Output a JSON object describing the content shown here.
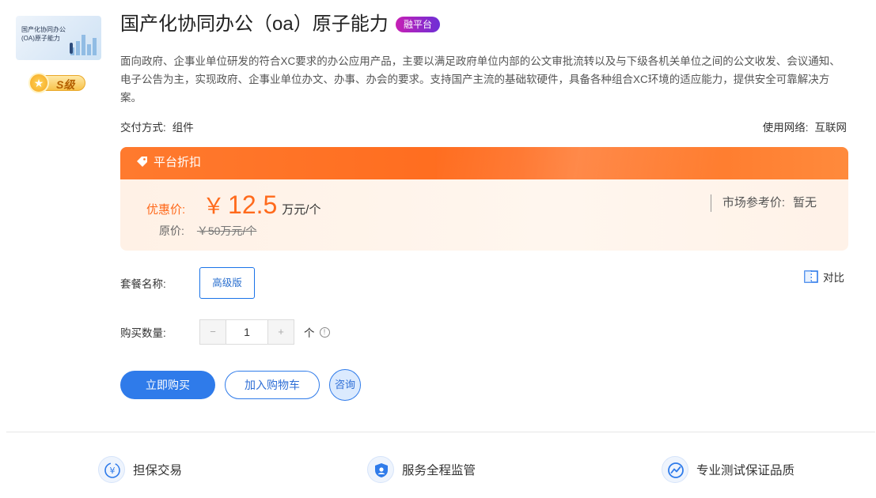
{
  "product": {
    "thumbnail_text_line1": "国产化协同办公",
    "thumbnail_text_line2": "(OA)原子能力",
    "level_badge": "S级",
    "title": "国产化协同办公（oa）原子能力",
    "platform_badge": "融平台",
    "description": "面向政府、企事业单位研发的符合XC要求的办公应用产品，主要以满足政府单位内部的公文审批流转以及与下级各机关单位之间的公文收发、会议通知、电子公告为主，实现政府、企事业单位办文、办事、办会的要求。支持国产主流的基础软硬件，具备各种组合XC环境的适应能力，提供安全可靠解决方案。",
    "delivery_label": "交付方式:",
    "delivery_value": "组件",
    "network_label": "使用网络:",
    "network_value": "互联网"
  },
  "price": {
    "banner_label": "平台折扣",
    "discount_label": "优惠价:",
    "currency": "￥",
    "discount_value": "12.5",
    "unit": "万元/个",
    "original_label": "原价:",
    "original_value": "￥50万元/个",
    "market_label": "市场参考价:",
    "market_value": "暂无"
  },
  "package": {
    "label": "套餐名称:",
    "option": "高级版"
  },
  "compare": {
    "label": "对比"
  },
  "quantity": {
    "label": "购买数量:",
    "minus": "−",
    "value": "1",
    "plus": "+",
    "unit": "个",
    "info": "!"
  },
  "actions": {
    "buy": "立即购买",
    "cart": "加入购物车",
    "consult": "咨询"
  },
  "features": [
    {
      "label": "担保交易",
      "icon": "yuan-shield-icon"
    },
    {
      "label": "服务全程监管",
      "icon": "user-shield-icon"
    },
    {
      "label": "专业测试保证品质",
      "icon": "quality-check-icon"
    }
  ],
  "colors": {
    "accent": "#2f7bea",
    "price": "#ff6a1c",
    "badge_start": "#c71fb4",
    "badge_end": "#6d2fd6"
  }
}
